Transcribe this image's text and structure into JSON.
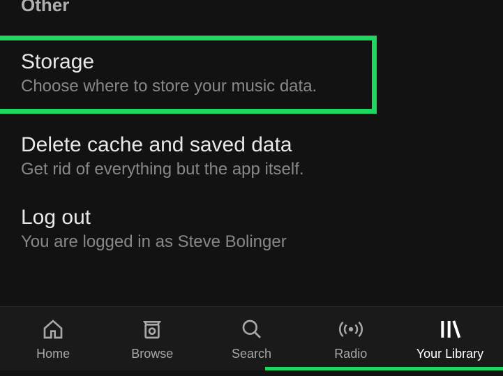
{
  "section_header": "Other",
  "settings": {
    "storage": {
      "title": "Storage",
      "subtitle": "Choose where to store your music data."
    },
    "delete_cache": {
      "title": "Delete cache and saved data",
      "subtitle": "Get rid of everything but the app itself."
    },
    "logout": {
      "title": "Log out",
      "subtitle": "You are logged in as Steve Bolinger"
    }
  },
  "nav": {
    "home": "Home",
    "browse": "Browse",
    "search": "Search",
    "radio": "Radio",
    "library": "Your Library"
  }
}
